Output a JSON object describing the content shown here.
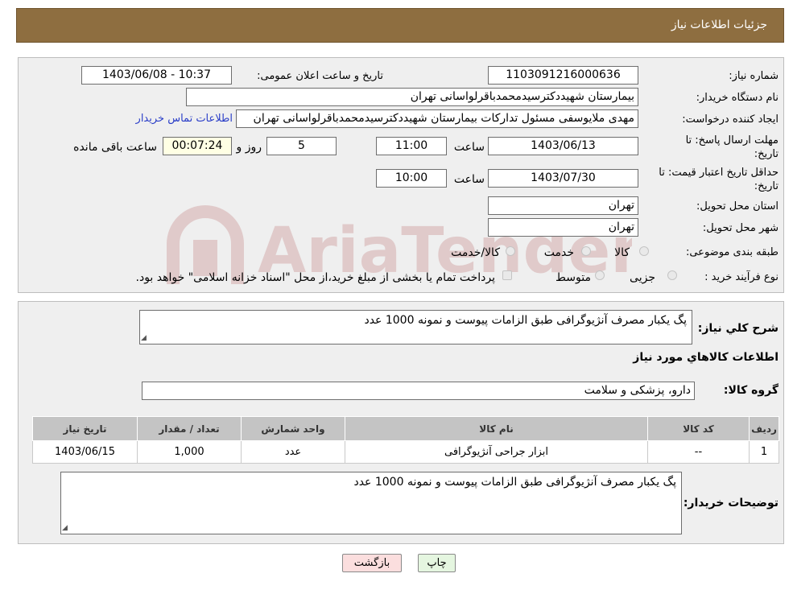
{
  "header": {
    "title": "جزئیات اطلاعات نیاز"
  },
  "watermark": {
    "text": "AriaTender.neT"
  },
  "form": {
    "need_number": {
      "label": "شماره نیاز:",
      "value": "1103091216000636"
    },
    "announce_datetime": {
      "label": "تاریخ و ساعت اعلان عمومی:",
      "value": "1403/06/08 - 10:37"
    },
    "buyer_org": {
      "label": "نام دستگاه خریدار:",
      "value": "بیمارستان شهیددکترسیدمحمدباقرلواسانی تهران"
    },
    "requester": {
      "label": "ایجاد کننده درخواست:",
      "value": "مهدی ملایوسفی مسئول تدارکات بیمارستان شهیددکترسیدمحمدباقرلواسانی تهران",
      "contact_link": "اطلاعات تماس خریدار"
    },
    "deadline": {
      "label_line1": "مهلت ارسال پاسخ: تا",
      "label_line2": "تاریخ:",
      "date": "1403/06/13",
      "time_label": "ساعت",
      "time": "11:00",
      "days": "5",
      "days_label": "روز و",
      "remaining": "00:07:24",
      "remaining_label": "ساعت باقی مانده"
    },
    "price_validity": {
      "label_line1": "حداقل تاریخ اعتبار قیمت: تا",
      "label_line2": "تاریخ:",
      "date": "1403/07/30",
      "time_label": "ساعت",
      "time": "10:00"
    },
    "delivery_province": {
      "label": "استان محل تحویل:",
      "value": "تهران"
    },
    "delivery_city": {
      "label": "شهر محل تحویل:",
      "value": "تهران"
    },
    "category": {
      "label": "طبقه بندی موضوعی:",
      "options": [
        "کالا",
        "خدمت",
        "کالا/خدمت"
      ]
    },
    "purchase_process": {
      "label": "نوع فرآیند خرید :",
      "options": [
        "جزیی",
        "متوسط"
      ],
      "note": "پرداخت تمام یا بخشی از مبلغ خرید،از محل \"اسناد خزانه اسلامی\" خواهد بود."
    }
  },
  "summary": {
    "label": "شرح کلي نياز:",
    "value": "پگ یکبار مصرف آنژیوگرافی طبق الزامات پیوست و نمونه 1000 عدد"
  },
  "goods_info_title": "اطلاعات کالاهاي مورد نياز",
  "goods_group": {
    "label": "گروه کالا:",
    "value": "دارو، پزشکی و سلامت"
  },
  "items_table": {
    "headers": [
      "رديف",
      "کد کالا",
      "نام کالا",
      "واحد شمارش",
      "تعداد / مقدار",
      "تاريخ نياز"
    ],
    "rows": [
      {
        "row": "1",
        "code": "--",
        "name": "ابزار جراحی آنژیوگرافی",
        "unit": "عدد",
        "qty": "1,000",
        "date": "1403/06/15"
      }
    ]
  },
  "buyer_notes": {
    "label": "توضيحات خريدار:",
    "value": "پگ یکبار مصرف آنژیوگرافی طبق الزامات پیوست و نمونه 1000 عدد"
  },
  "buttons": {
    "print": "چاپ",
    "back": "بازگشت"
  }
}
